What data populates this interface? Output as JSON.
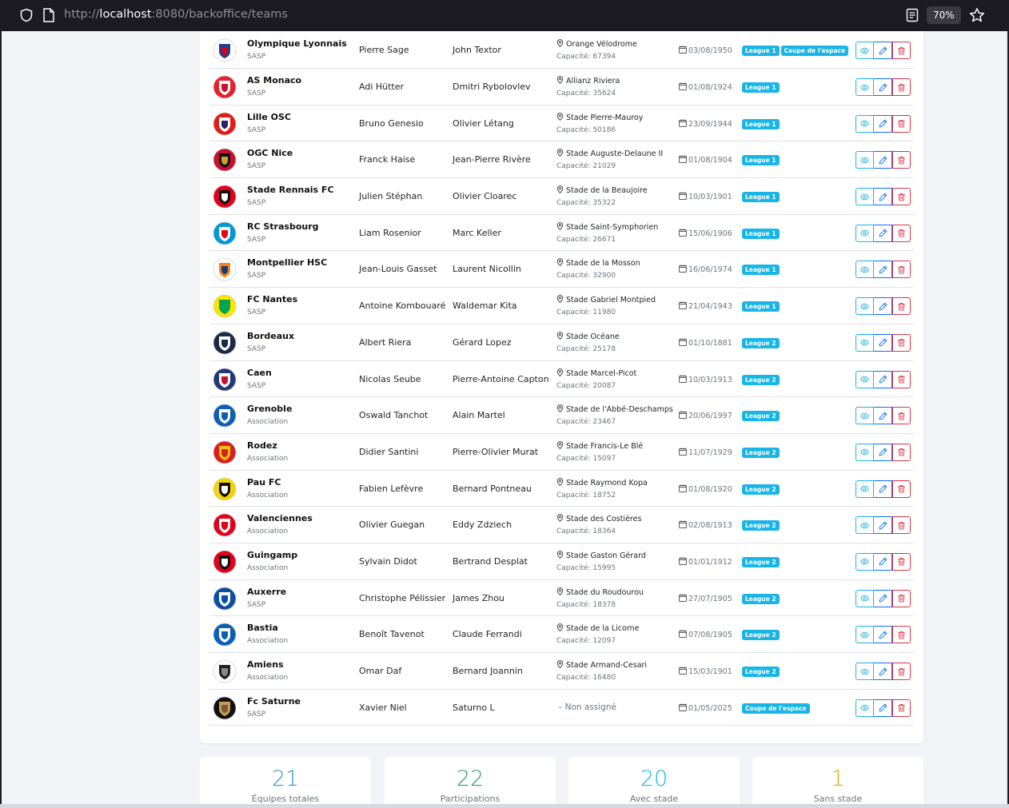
{
  "browser": {
    "url_scheme": "http://",
    "url_host": "localhost",
    "url_rest": ":8080/backoffice/teams",
    "zoom": "70%",
    "icons": [
      "shield-icon",
      "page-icon",
      "reader-view-icon",
      "bookmark-star-icon"
    ]
  },
  "colors": {
    "badge": "#17b6e6",
    "view_btn": "#17b6e6",
    "edit_btn": "#0d6efd",
    "delete_btn": "#dc3545",
    "stat_total": "#3d8fd6",
    "stat_participations": "#2e9b6a",
    "stat_with_stadium": "#17b6e6",
    "stat_without_stadium": "#f0a500"
  },
  "teams": [
    {
      "name": "Olympique Lyonnais",
      "type": "SASP",
      "coach": "Pierre Sage",
      "president": "John Textor",
      "stadium": "Orange Vélodrome",
      "capacity": "Capacité: 67394",
      "date": "03/08/1950",
      "badges": [
        "League 1",
        "Coupe de l'espace"
      ],
      "logo": {
        "a": "#ffffff",
        "b": "#1c3f94",
        "c": "#d6001c"
      }
    },
    {
      "name": "AS Monaco",
      "type": "SASP",
      "coach": "Adi Hütter",
      "president": "Dmitri Rybolovlev",
      "stadium": "Allianz Riviera",
      "capacity": "Capacité: 35624",
      "date": "01/08/1924",
      "badges": [
        "League 1"
      ],
      "logo": {
        "a": "#e5212b",
        "b": "#ffffff",
        "c": "#c8102e"
      }
    },
    {
      "name": "Lille OSC",
      "type": "SASP",
      "coach": "Bruno Genesio",
      "president": "Olivier Létang",
      "stadium": "Stade Pierre-Mauroy",
      "capacity": "Capacité: 50186",
      "date": "23/09/1944",
      "badges": [
        "League 1"
      ],
      "logo": {
        "a": "#e01e13",
        "b": "#ffffff",
        "c": "#24216a"
      }
    },
    {
      "name": "OGC Nice",
      "type": "SASP",
      "coach": "Franck Haise",
      "president": "Jean-Pierre Rivère",
      "stadium": "Stade Auguste-Delaune II",
      "capacity": "Capacité: 21029",
      "date": "01/08/1904",
      "badges": [
        "League 1"
      ],
      "logo": {
        "a": "#c8102e",
        "b": "#111111",
        "c": "#c9a227"
      }
    },
    {
      "name": "Stade Rennais FC",
      "type": "SASP",
      "coach": "Julien Stéphan",
      "president": "Olivier Cloarec",
      "stadium": "Stade de la Beaujoire",
      "capacity": "Capacité: 35322",
      "date": "10/03/1901",
      "badges": [
        "League 1"
      ],
      "logo": {
        "a": "#e2001a",
        "b": "#111111",
        "c": "#ffffff"
      }
    },
    {
      "name": "RC Strasbourg",
      "type": "SASP",
      "coach": "Liam Rosenior",
      "president": "Marc Keller",
      "stadium": "Stade Saint-Symphorien",
      "capacity": "Capacité: 26671",
      "date": "15/06/1906",
      "badges": [
        "League 1"
      ],
      "logo": {
        "a": "#0098d8",
        "b": "#ffffff",
        "c": "#e30613"
      }
    },
    {
      "name": "Montpellier HSC",
      "type": "SASP",
      "coach": "Jean-Louis Gasset",
      "president": "Laurent Nicollin",
      "stadium": "Stade de la Mosson",
      "capacity": "Capacité: 32900",
      "date": "16/06/1974",
      "badges": [
        "League 1"
      ],
      "logo": {
        "a": "#ffffff",
        "b": "#f58220",
        "c": "#1d3c6e"
      }
    },
    {
      "name": "FC Nantes",
      "type": "SASP",
      "coach": "Antoine Kombouaré",
      "president": "Waldemar Kita",
      "stadium": "Stade Gabriel Montpied",
      "capacity": "Capacité: 11980",
      "date": "21/04/1943",
      "badges": [
        "League 1"
      ],
      "logo": {
        "a": "#fce300",
        "b": "#00a650",
        "c": "#00a650"
      }
    },
    {
      "name": "Bordeaux",
      "type": "SASP",
      "coach": "Albert Riera",
      "president": "Gérard Lopez",
      "stadium": "Stade Océane",
      "capacity": "Capacité: 25178",
      "date": "01/10/1881",
      "badges": [
        "League 2"
      ],
      "logo": {
        "a": "#1b2a4a",
        "b": "#ffffff",
        "c": "#1b2a4a"
      }
    },
    {
      "name": "Caen",
      "type": "SASP",
      "coach": "Nicolas Seube",
      "president": "Pierre-Antoine Capton",
      "stadium": "Stade Marcel-Picot",
      "capacity": "Capacité: 20087",
      "date": "10/03/1913",
      "badges": [
        "League 2"
      ],
      "logo": {
        "a": "#1f3a7a",
        "b": "#ffffff",
        "c": "#c8102e"
      }
    },
    {
      "name": "Grenoble",
      "type": "Association",
      "coach": "Oswald Tanchot",
      "president": "Alain Martel",
      "stadium": "Stade de l'Abbé-Deschamps",
      "capacity": "Capacité: 23467",
      "date": "20/06/1997",
      "badges": [
        "League 2"
      ],
      "logo": {
        "a": "#0c5fb5",
        "b": "#ffffff",
        "c": "#0c5fb5"
      }
    },
    {
      "name": "Rodez",
      "type": "Association",
      "coach": "Didier Santini",
      "president": "Pierre-Olivier Murat",
      "stadium": "Stade Francis-Le Blé",
      "capacity": "Capacité: 15097",
      "date": "11/07/1929",
      "badges": [
        "League 2"
      ],
      "logo": {
        "a": "#d81f26",
        "b": "#f4c400",
        "c": "#d81f26"
      }
    },
    {
      "name": "Pau FC",
      "type": "Association",
      "coach": "Fabien Lefèvre",
      "president": "Bernard Pontneau",
      "stadium": "Stade Raymond Kopa",
      "capacity": "Capacité: 18752",
      "date": "01/08/1920",
      "badges": [
        "League 2"
      ],
      "logo": {
        "a": "#f5d400",
        "b": "#111111",
        "c": "#ffffff"
      }
    },
    {
      "name": "Valenciennes",
      "type": "Association",
      "coach": "Olivier Guegan",
      "president": "Eddy Zdziech",
      "stadium": "Stade des Costières",
      "capacity": "Capacité: 18364",
      "date": "02/08/1913",
      "badges": [
        "League 2"
      ],
      "logo": {
        "a": "#e2001a",
        "b": "#ffffff",
        "c": "#e2001a"
      }
    },
    {
      "name": "Guingamp",
      "type": "Association",
      "coach": "Sylvain Didot",
      "president": "Bertrand Desplat",
      "stadium": "Stade Gaston Gérard",
      "capacity": "Capacité: 15995",
      "date": "01/01/1912",
      "badges": [
        "League 2"
      ],
      "logo": {
        "a": "#e2001a",
        "b": "#111111",
        "c": "#ffffff"
      }
    },
    {
      "name": "Auxerre",
      "type": "SASP",
      "coach": "Christophe Pélissier",
      "president": "James Zhou",
      "stadium": "Stade du Roudourou",
      "capacity": "Capacité: 18378",
      "date": "27/07/1905",
      "badges": [
        "League 2"
      ],
      "logo": {
        "a": "#0b4ea2",
        "b": "#ffffff",
        "c": "#0b4ea2"
      }
    },
    {
      "name": "Bastia",
      "type": "Association",
      "coach": "Benoît Tavenot",
      "president": "Claude Ferrandi",
      "stadium": "Stade de la Licorne",
      "capacity": "Capacité: 12097",
      "date": "07/08/1905",
      "badges": [
        "League 2"
      ],
      "logo": {
        "a": "#0a5fb4",
        "b": "#ffffff",
        "c": "#0a5fb4"
      }
    },
    {
      "name": "Amiens",
      "type": "Association",
      "coach": "Omar Daf",
      "president": "Bernard Joannin",
      "stadium": "Stade Armand-Cesari",
      "capacity": "Capacité: 16480",
      "date": "15/03/1901",
      "badges": [
        "League 2"
      ],
      "logo": {
        "a": "#ffffff",
        "b": "#222222",
        "c": "#888888"
      }
    },
    {
      "name": "Fc Saturne",
      "type": "SASP",
      "coach": "Xavier Niel",
      "president": "Saturno L",
      "stadium": "",
      "unassigned": "–  Non assigné",
      "capacity": "",
      "date": "01/05/2025",
      "badges": [
        "Coupe de l'espace"
      ],
      "logo": {
        "a": "#111111",
        "b": "#c89a5a",
        "c": "#7a5a30"
      }
    }
  ],
  "stats": [
    {
      "value": "21",
      "label": "Équipes totales",
      "color": "#3d8fd6"
    },
    {
      "value": "22",
      "label": "Participations",
      "color": "#2e9b6a"
    },
    {
      "value": "20",
      "label": "Avec stade",
      "color": "#17b6e6"
    },
    {
      "value": "1",
      "label": "Sans stade",
      "color": "#f0a500"
    }
  ]
}
